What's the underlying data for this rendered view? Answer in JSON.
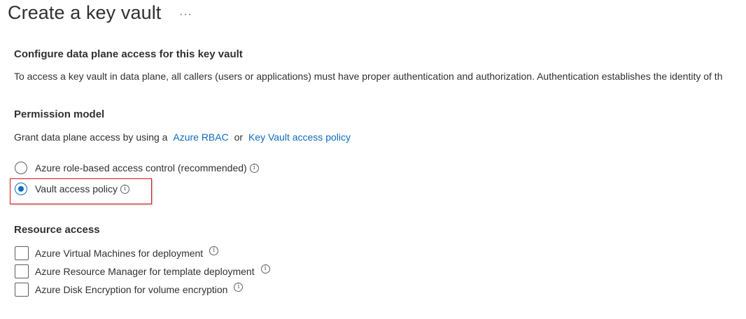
{
  "header": {
    "title": "Create a key vault",
    "more_label": "···"
  },
  "data_plane": {
    "heading": "Configure data plane access for this key vault",
    "description": "To access a key vault in data plane, all callers (users or applications) must have proper authentication and authorization. Authentication establishes the identity of th"
  },
  "permission_model": {
    "heading": "Permission model",
    "grant_prefix": "Grant data plane access by using a",
    "link_rbac": "Azure RBAC",
    "or_text": "or",
    "link_policy": "Key Vault access policy",
    "options": [
      {
        "label": "Azure role-based access control (recommended)",
        "selected": false
      },
      {
        "label": "Vault access policy",
        "selected": true
      }
    ]
  },
  "resource_access": {
    "heading": "Resource access",
    "items": [
      {
        "label": "Azure Virtual Machines for deployment",
        "checked": false
      },
      {
        "label": "Azure Resource Manager for template deployment",
        "checked": false
      },
      {
        "label": "Azure Disk Encryption for volume encryption",
        "checked": false
      }
    ]
  },
  "icons": {
    "info": "info-icon",
    "more": "more-horizontal-icon"
  },
  "colors": {
    "link": "#0f6cbd",
    "highlight": "#e0141b",
    "text": "#323130"
  }
}
